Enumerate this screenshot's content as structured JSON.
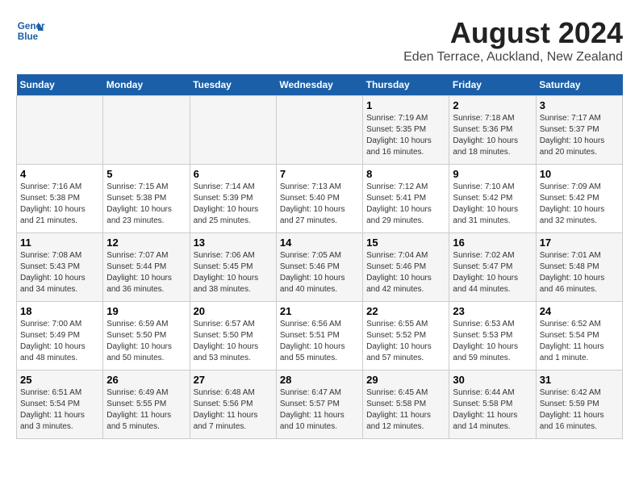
{
  "header": {
    "title": "August 2024",
    "subtitle": "Eden Terrace, Auckland, New Zealand",
    "logo_line1": "General",
    "logo_line2": "Blue"
  },
  "days_of_week": [
    "Sunday",
    "Monday",
    "Tuesday",
    "Wednesday",
    "Thursday",
    "Friday",
    "Saturday"
  ],
  "weeks": [
    [
      {
        "day": "",
        "info": ""
      },
      {
        "day": "",
        "info": ""
      },
      {
        "day": "",
        "info": ""
      },
      {
        "day": "",
        "info": ""
      },
      {
        "day": "1",
        "info": "Sunrise: 7:19 AM\nSunset: 5:35 PM\nDaylight: 10 hours\nand 16 minutes."
      },
      {
        "day": "2",
        "info": "Sunrise: 7:18 AM\nSunset: 5:36 PM\nDaylight: 10 hours\nand 18 minutes."
      },
      {
        "day": "3",
        "info": "Sunrise: 7:17 AM\nSunset: 5:37 PM\nDaylight: 10 hours\nand 20 minutes."
      }
    ],
    [
      {
        "day": "4",
        "info": "Sunrise: 7:16 AM\nSunset: 5:38 PM\nDaylight: 10 hours\nand 21 minutes."
      },
      {
        "day": "5",
        "info": "Sunrise: 7:15 AM\nSunset: 5:38 PM\nDaylight: 10 hours\nand 23 minutes."
      },
      {
        "day": "6",
        "info": "Sunrise: 7:14 AM\nSunset: 5:39 PM\nDaylight: 10 hours\nand 25 minutes."
      },
      {
        "day": "7",
        "info": "Sunrise: 7:13 AM\nSunset: 5:40 PM\nDaylight: 10 hours\nand 27 minutes."
      },
      {
        "day": "8",
        "info": "Sunrise: 7:12 AM\nSunset: 5:41 PM\nDaylight: 10 hours\nand 29 minutes."
      },
      {
        "day": "9",
        "info": "Sunrise: 7:10 AM\nSunset: 5:42 PM\nDaylight: 10 hours\nand 31 minutes."
      },
      {
        "day": "10",
        "info": "Sunrise: 7:09 AM\nSunset: 5:42 PM\nDaylight: 10 hours\nand 32 minutes."
      }
    ],
    [
      {
        "day": "11",
        "info": "Sunrise: 7:08 AM\nSunset: 5:43 PM\nDaylight: 10 hours\nand 34 minutes."
      },
      {
        "day": "12",
        "info": "Sunrise: 7:07 AM\nSunset: 5:44 PM\nDaylight: 10 hours\nand 36 minutes."
      },
      {
        "day": "13",
        "info": "Sunrise: 7:06 AM\nSunset: 5:45 PM\nDaylight: 10 hours\nand 38 minutes."
      },
      {
        "day": "14",
        "info": "Sunrise: 7:05 AM\nSunset: 5:46 PM\nDaylight: 10 hours\nand 40 minutes."
      },
      {
        "day": "15",
        "info": "Sunrise: 7:04 AM\nSunset: 5:46 PM\nDaylight: 10 hours\nand 42 minutes."
      },
      {
        "day": "16",
        "info": "Sunrise: 7:02 AM\nSunset: 5:47 PM\nDaylight: 10 hours\nand 44 minutes."
      },
      {
        "day": "17",
        "info": "Sunrise: 7:01 AM\nSunset: 5:48 PM\nDaylight: 10 hours\nand 46 minutes."
      }
    ],
    [
      {
        "day": "18",
        "info": "Sunrise: 7:00 AM\nSunset: 5:49 PM\nDaylight: 10 hours\nand 48 minutes."
      },
      {
        "day": "19",
        "info": "Sunrise: 6:59 AM\nSunset: 5:50 PM\nDaylight: 10 hours\nand 50 minutes."
      },
      {
        "day": "20",
        "info": "Sunrise: 6:57 AM\nSunset: 5:50 PM\nDaylight: 10 hours\nand 53 minutes."
      },
      {
        "day": "21",
        "info": "Sunrise: 6:56 AM\nSunset: 5:51 PM\nDaylight: 10 hours\nand 55 minutes."
      },
      {
        "day": "22",
        "info": "Sunrise: 6:55 AM\nSunset: 5:52 PM\nDaylight: 10 hours\nand 57 minutes."
      },
      {
        "day": "23",
        "info": "Sunrise: 6:53 AM\nSunset: 5:53 PM\nDaylight: 10 hours\nand 59 minutes."
      },
      {
        "day": "24",
        "info": "Sunrise: 6:52 AM\nSunset: 5:54 PM\nDaylight: 11 hours\nand 1 minute."
      }
    ],
    [
      {
        "day": "25",
        "info": "Sunrise: 6:51 AM\nSunset: 5:54 PM\nDaylight: 11 hours\nand 3 minutes."
      },
      {
        "day": "26",
        "info": "Sunrise: 6:49 AM\nSunset: 5:55 PM\nDaylight: 11 hours\nand 5 minutes."
      },
      {
        "day": "27",
        "info": "Sunrise: 6:48 AM\nSunset: 5:56 PM\nDaylight: 11 hours\nand 7 minutes."
      },
      {
        "day": "28",
        "info": "Sunrise: 6:47 AM\nSunset: 5:57 PM\nDaylight: 11 hours\nand 10 minutes."
      },
      {
        "day": "29",
        "info": "Sunrise: 6:45 AM\nSunset: 5:58 PM\nDaylight: 11 hours\nand 12 minutes."
      },
      {
        "day": "30",
        "info": "Sunrise: 6:44 AM\nSunset: 5:58 PM\nDaylight: 11 hours\nand 14 minutes."
      },
      {
        "day": "31",
        "info": "Sunrise: 6:42 AM\nSunset: 5:59 PM\nDaylight: 11 hours\nand 16 minutes."
      }
    ]
  ]
}
